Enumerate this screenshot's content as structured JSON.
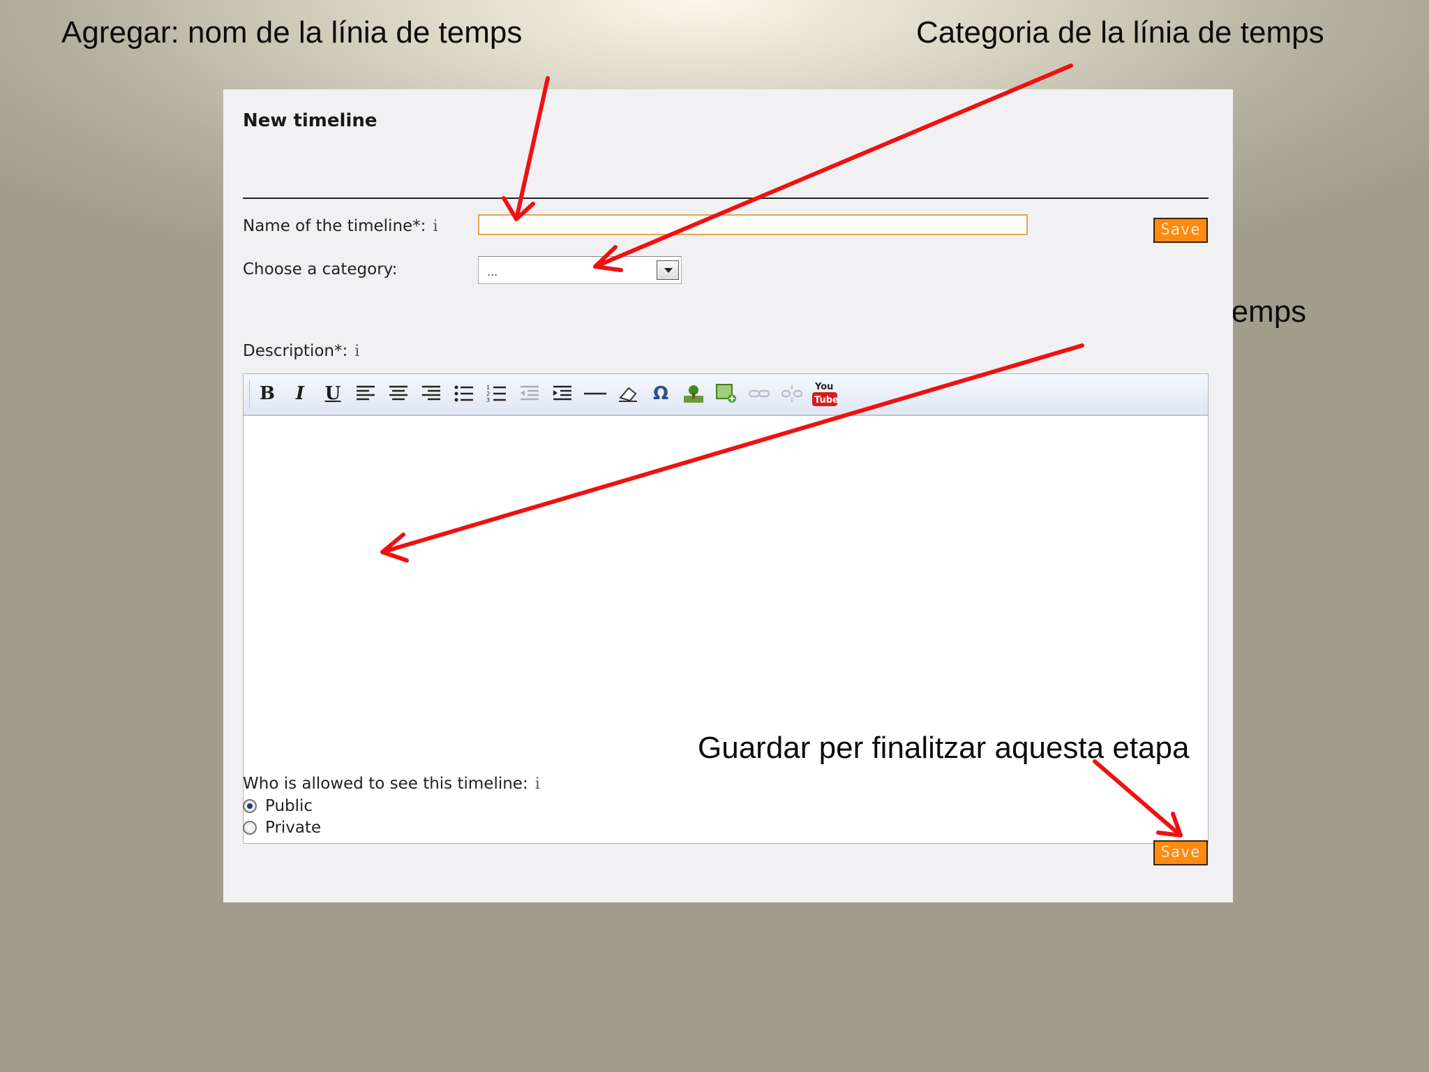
{
  "captions": {
    "name": "Agregar: nom de la línia de temps",
    "category": "Categoria de la línia de temps",
    "description": "Descripció de la línia de temps",
    "save": "Guardar per finalitzar aquesta etapa"
  },
  "form": {
    "title": "New timeline",
    "name_label": "Name of the timeline*:",
    "name_value": "",
    "category_label": "Choose a category:",
    "category_selected": "...",
    "description_label": "Description*:",
    "visibility_label": "Who is allowed to see this timeline:",
    "visibility_options": [
      "Public",
      "Private"
    ],
    "visibility_selected": "Public",
    "save_label": "Save",
    "info_glyph": "i"
  },
  "toolbar": [
    {
      "name": "bold-button",
      "glyph": "B"
    },
    {
      "name": "italic-button",
      "glyph": "I"
    },
    {
      "name": "underline-button",
      "glyph": "U"
    },
    {
      "name": "align-left-button",
      "icon": "align-left-icon"
    },
    {
      "name": "align-center-button",
      "icon": "align-center-icon"
    },
    {
      "name": "align-right-button",
      "icon": "align-right-icon"
    },
    {
      "name": "bullet-list-button",
      "icon": "bullet-list-icon"
    },
    {
      "name": "numbered-list-button",
      "icon": "numbered-list-icon"
    },
    {
      "name": "outdent-button",
      "icon": "outdent-icon"
    },
    {
      "name": "indent-button",
      "icon": "indent-icon"
    },
    {
      "name": "horizontal-rule-button",
      "icon": "horizontal-rule-icon"
    },
    {
      "name": "eraser-button",
      "icon": "eraser-icon"
    },
    {
      "name": "special-char-button",
      "glyph": "Ω"
    },
    {
      "name": "image-button",
      "icon": "image-icon"
    },
    {
      "name": "insert-image-button",
      "icon": "insert-image-icon"
    },
    {
      "name": "link-button",
      "icon": "link-icon"
    },
    {
      "name": "unlink-button",
      "icon": "unlink-icon"
    },
    {
      "name": "youtube-button",
      "icon": "youtube-icon"
    }
  ],
  "colors": {
    "save_button": "#ff8a12",
    "arrow": "#ef1111",
    "input_border": "#e0a650"
  }
}
